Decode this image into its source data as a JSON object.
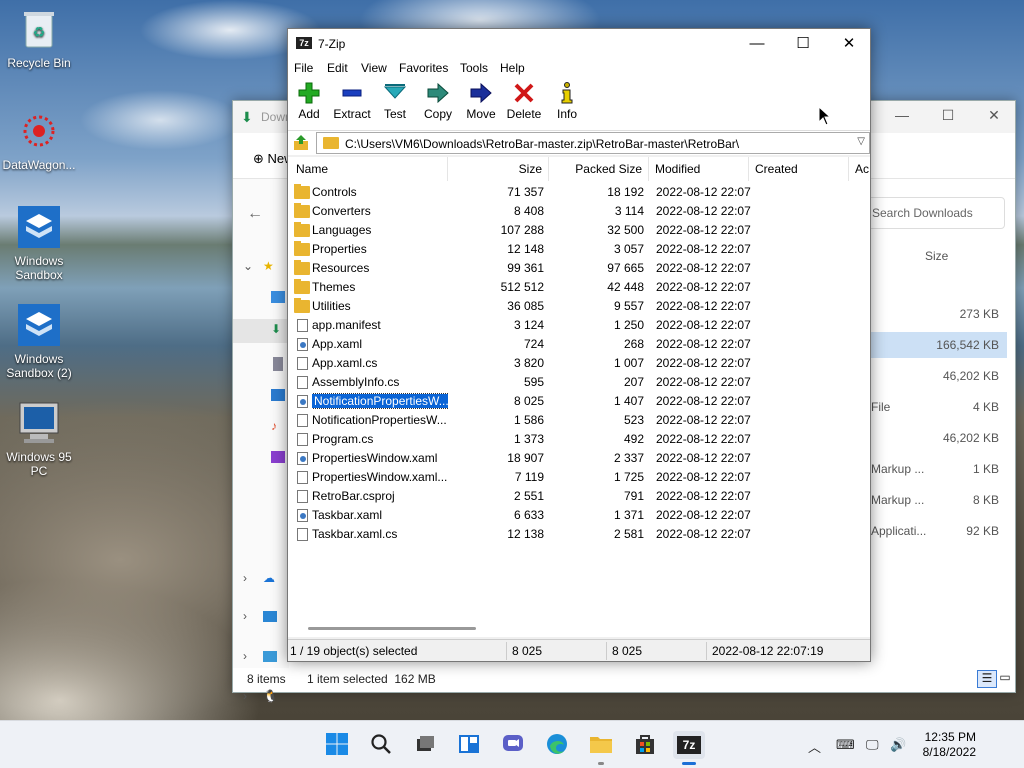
{
  "desktop": {
    "icons": [
      {
        "label": "Recycle Bin",
        "icon": "recycle-bin-icon"
      },
      {
        "label": "DataWagon...",
        "icon": "datawagon-icon"
      },
      {
        "label": "Windows Sandbox",
        "icon": "sandbox-icon"
      },
      {
        "label": "Windows Sandbox (2)",
        "icon": "sandbox-icon"
      },
      {
        "label": "Windows 95 PC",
        "icon": "computer-icon"
      }
    ]
  },
  "explorer": {
    "title": "Downloads",
    "new_label": "New",
    "search_placeholder": "Search Downloads",
    "size_header": "Size",
    "rows": [
      {
        "type": "",
        "size": "273 KB"
      },
      {
        "type": "",
        "size": "166,542 KB"
      },
      {
        "type": "",
        "size": "46,202 KB"
      },
      {
        "type": "File",
        "size": "4 KB"
      },
      {
        "type": "",
        "size": "46,202 KB"
      },
      {
        "type": "Markup ...",
        "size": "1 KB"
      },
      {
        "type": "Markup ...",
        "size": "8 KB"
      },
      {
        "type": "Applicati...",
        "size": "92 KB"
      }
    ],
    "status_items": "8 items",
    "status_selected": "1 item selected  162 MB"
  },
  "sevenzip": {
    "title": "7-Zip",
    "logo": "7z",
    "menu": [
      "File",
      "Edit",
      "View",
      "Favorites",
      "Tools",
      "Help"
    ],
    "toolbar": [
      {
        "label": "Add",
        "icon": "add-icon",
        "color": "#22aa22"
      },
      {
        "label": "Extract",
        "icon": "extract-icon",
        "color": "#1a3fbf"
      },
      {
        "label": "Test",
        "icon": "test-icon",
        "color": "#27a9b8"
      },
      {
        "label": "Copy",
        "icon": "copy-icon",
        "color": "#2d8a7a"
      },
      {
        "label": "Move",
        "icon": "move-icon",
        "color": "#1a2f9a"
      },
      {
        "label": "Delete",
        "icon": "delete-icon",
        "color": "#d01818"
      },
      {
        "label": "Info",
        "icon": "info-icon",
        "color": "#c8b000"
      }
    ],
    "address": "C:\\Users\\VM6\\Downloads\\RetroBar-master.zip\\RetroBar-master\\RetroBar\\",
    "columns": [
      "Name",
      "Size",
      "Packed Size",
      "Modified",
      "Created",
      "Ac"
    ],
    "files": [
      {
        "name": "Controls",
        "size": "71 357",
        "packed": "18 192",
        "modified": "2022-08-12 22:07",
        "kind": "folder"
      },
      {
        "name": "Converters",
        "size": "8 408",
        "packed": "3 114",
        "modified": "2022-08-12 22:07",
        "kind": "folder"
      },
      {
        "name": "Languages",
        "size": "107 288",
        "packed": "32 500",
        "modified": "2022-08-12 22:07",
        "kind": "folder"
      },
      {
        "name": "Properties",
        "size": "12 148",
        "packed": "3 057",
        "modified": "2022-08-12 22:07",
        "kind": "folder"
      },
      {
        "name": "Resources",
        "size": "99 361",
        "packed": "97 665",
        "modified": "2022-08-12 22:07",
        "kind": "folder"
      },
      {
        "name": "Themes",
        "size": "512 512",
        "packed": "42 448",
        "modified": "2022-08-12 22:07",
        "kind": "folder"
      },
      {
        "name": "Utilities",
        "size": "36 085",
        "packed": "9 557",
        "modified": "2022-08-12 22:07",
        "kind": "folder"
      },
      {
        "name": "app.manifest",
        "size": "3 124",
        "packed": "1 250",
        "modified": "2022-08-12 22:07",
        "kind": "doc"
      },
      {
        "name": "App.xaml",
        "size": "724",
        "packed": "268",
        "modified": "2022-08-12 22:07",
        "kind": "xaml"
      },
      {
        "name": "App.xaml.cs",
        "size": "3 820",
        "packed": "1 007",
        "modified": "2022-08-12 22:07",
        "kind": "doc"
      },
      {
        "name": "AssemblyInfo.cs",
        "size": "595",
        "packed": "207",
        "modified": "2022-08-12 22:07",
        "kind": "doc"
      },
      {
        "name": "NotificationPropertiesW...",
        "size": "8 025",
        "packed": "1 407",
        "modified": "2022-08-12 22:07",
        "kind": "xaml",
        "selected": true
      },
      {
        "name": "NotificationPropertiesW...",
        "size": "1 586",
        "packed": "523",
        "modified": "2022-08-12 22:07",
        "kind": "doc"
      },
      {
        "name": "Program.cs",
        "size": "1 373",
        "packed": "492",
        "modified": "2022-08-12 22:07",
        "kind": "doc"
      },
      {
        "name": "PropertiesWindow.xaml",
        "size": "18 907",
        "packed": "2 337",
        "modified": "2022-08-12 22:07",
        "kind": "xaml"
      },
      {
        "name": "PropertiesWindow.xaml...",
        "size": "7 119",
        "packed": "1 725",
        "modified": "2022-08-12 22:07",
        "kind": "doc"
      },
      {
        "name": "RetroBar.csproj",
        "size": "2 551",
        "packed": "791",
        "modified": "2022-08-12 22:07",
        "kind": "doc"
      },
      {
        "name": "Taskbar.xaml",
        "size": "6 633",
        "packed": "1 371",
        "modified": "2022-08-12 22:07",
        "kind": "xaml"
      },
      {
        "name": "Taskbar.xaml.cs",
        "size": "12 138",
        "packed": "2 581",
        "modified": "2022-08-12 22:07",
        "kind": "doc"
      }
    ],
    "status": {
      "selection": "1 / 19 object(s) selected",
      "size": "8 025",
      "packed": "8 025",
      "modified": "2022-08-12 22:07:19"
    }
  },
  "taskbar": {
    "time": "12:35 PM",
    "date": "8/18/2022",
    "notification_count": "1",
    "accent": "#1a6fd6"
  }
}
